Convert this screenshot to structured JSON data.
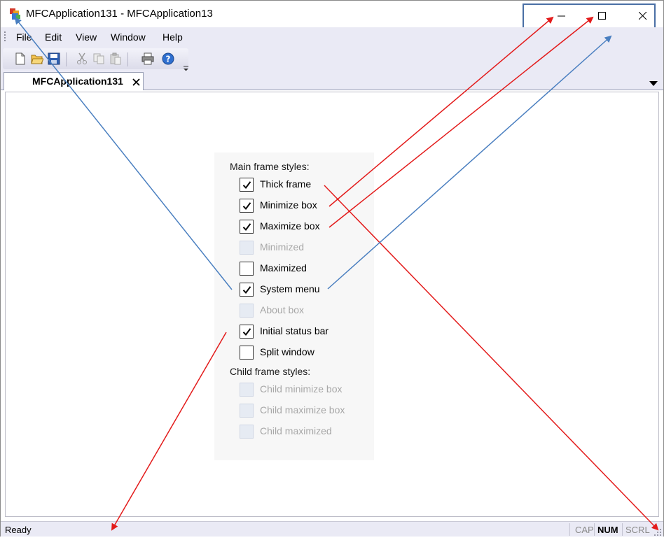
{
  "window": {
    "title": "MFCApplication131 - MFCApplication13"
  },
  "menu": [
    "File",
    "Edit",
    "View",
    "Window",
    "Help"
  ],
  "toolbar": {
    "buttons": [
      "new-file-icon",
      "open-folder-icon",
      "save-icon",
      "cut-icon",
      "copy-icon",
      "paste-icon",
      "print-icon",
      "help-icon"
    ]
  },
  "tab": {
    "label": "MFCApplication131"
  },
  "panel": {
    "main_label": "Main frame styles:",
    "main_options": [
      {
        "label": "Thick frame",
        "checked": true,
        "enabled": true
      },
      {
        "label": "Minimize box",
        "checked": true,
        "enabled": true
      },
      {
        "label": "Maximize box",
        "checked": true,
        "enabled": true
      },
      {
        "label": "Minimized",
        "checked": false,
        "enabled": false
      },
      {
        "label": "Maximized",
        "checked": false,
        "enabled": true
      },
      {
        "label": "System menu",
        "checked": true,
        "enabled": true
      },
      {
        "label": "About box",
        "checked": false,
        "enabled": false
      },
      {
        "label": "Initial status bar",
        "checked": true,
        "enabled": true
      },
      {
        "label": "Split window",
        "checked": false,
        "enabled": true
      }
    ],
    "child_label": "Child frame styles:",
    "child_options": [
      {
        "label": "Child minimize box",
        "checked": false,
        "enabled": false
      },
      {
        "label": "Child maximize box",
        "checked": false,
        "enabled": false
      },
      {
        "label": "Child maximized",
        "checked": false,
        "enabled": false
      }
    ]
  },
  "status": {
    "text": "Ready",
    "indicators": [
      {
        "label": "CAP",
        "active": false
      },
      {
        "label": "NUM",
        "active": true
      },
      {
        "label": "SCRL",
        "active": false
      }
    ]
  },
  "colors": {
    "annotation_red": "#e31b1b",
    "annotation_blue": "#4a7fc0",
    "highlight_box": "#4a6fa5",
    "chrome_bg": "#eaeaf5"
  }
}
